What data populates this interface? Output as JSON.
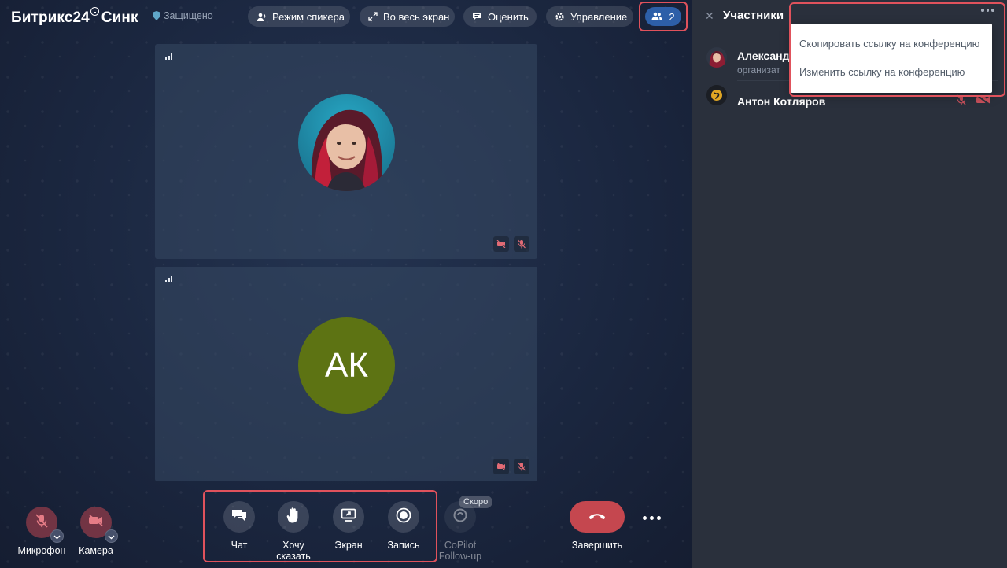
{
  "app": {
    "logo_text": "Битрикс24",
    "logo_suffix": "Синк",
    "secure_label": "Защищено"
  },
  "topbar": {
    "speaker_mode": "Режим спикера",
    "fullscreen": "Во весь экран",
    "rate": "Оценить",
    "manage": "Управление",
    "participants_count": "2"
  },
  "tiles": [
    {
      "initials": ""
    },
    {
      "initials": "АК",
      "color": "#5d7313"
    }
  ],
  "controls": {
    "microphone": "Микрофон",
    "camera": "Камера",
    "chat": "Чат",
    "raise_hand_line1": "Хочу",
    "raise_hand_line2": "сказать",
    "screen": "Экран",
    "record": "Запись",
    "copilot_line1": "CoPilot",
    "copilot_line2": "Follow-up",
    "soon_badge": "Скоро",
    "end_call": "Завершить"
  },
  "panel": {
    "title": "Участники",
    "participants": [
      {
        "name": "Александ",
        "role": "организат"
      },
      {
        "name": "Антон Котляров",
        "role": ""
      }
    ],
    "menu": {
      "copy_link": "Скопировать ссылку на конференцию",
      "edit_link": "Изменить ссылку на конференцию"
    }
  },
  "colors": {
    "accent_blue": "#2d5fa8",
    "end_call_red": "#c5474f",
    "highlight_red": "#e0525c",
    "avatar_green": "#5d7313"
  }
}
